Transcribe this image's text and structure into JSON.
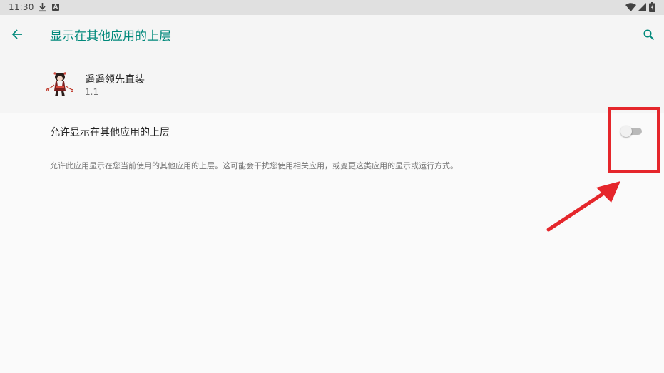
{
  "status_bar": {
    "time": "11:30",
    "notification_icon_text": "A",
    "icons": [
      "download-icon",
      "notification-a-icon",
      "wifi-icon",
      "signal-icon",
      "battery-icon"
    ]
  },
  "app_bar": {
    "title": "显示在其他应用的上层",
    "back_icon": "arrow-back-icon",
    "search_icon": "search-icon",
    "accent_color": "#00897b"
  },
  "app_info": {
    "name": "遥遥领先直装",
    "version": "1.1"
  },
  "setting": {
    "label": "允许显示在其他应用的上层",
    "toggle_on": false,
    "description": "允许此应用显示在您当前使用的其他应用的上层。这可能会干扰您使用相关应用，或变更这类应用的显示或运行方式。"
  },
  "annotations": {
    "highlight_color": "#e5262b"
  }
}
